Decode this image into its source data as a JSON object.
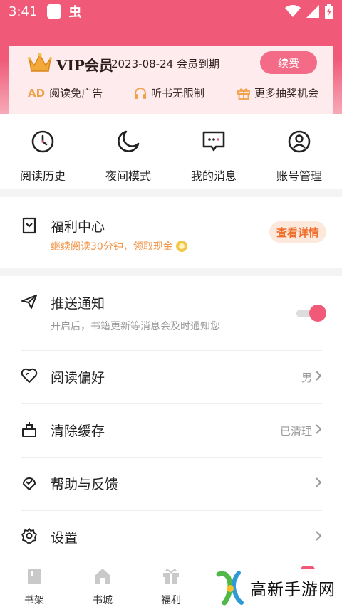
{
  "status_bar": {
    "time": "3:41",
    "app_icon_label": "虫"
  },
  "vip": {
    "title": "VIP会员",
    "expire_text": "2023-08-24 会员到期",
    "renew_label": "续费",
    "features": [
      {
        "icon": "AD",
        "label": "阅读免广告"
      },
      {
        "icon": "headphones-icon",
        "label": "听书无限制"
      },
      {
        "icon": "gift-icon",
        "label": "更多抽奖机会"
      }
    ]
  },
  "quick_actions": [
    {
      "icon": "clock-icon",
      "label": "阅读历史"
    },
    {
      "icon": "moon-icon",
      "label": "夜间模式"
    },
    {
      "icon": "message-icon",
      "label": "我的消息"
    },
    {
      "icon": "account-icon",
      "label": "账号管理"
    }
  ],
  "welfare": {
    "title": "福利中心",
    "subtitle": "继续阅读30分钟，领取现金",
    "button_label": "查看详情"
  },
  "settings": {
    "push": {
      "title": "推送通知",
      "subtitle": "开启后，书籍更新等消息会及时通知您",
      "enabled": true
    },
    "reading_pref": {
      "title": "阅读偏好",
      "value": "男"
    },
    "clear_cache": {
      "title": "清除缓存",
      "value": "已清理"
    },
    "help": {
      "title": "帮助与反馈"
    },
    "settings": {
      "title": "设置"
    }
  },
  "tabs": [
    {
      "label": "书架"
    },
    {
      "label": "书城"
    },
    {
      "label": "福利"
    }
  ],
  "watermark": {
    "text": "高新手游网"
  },
  "colors": {
    "accent": "#f05a78",
    "orange": "#f2964b",
    "vip_bg": "#fdebee"
  }
}
